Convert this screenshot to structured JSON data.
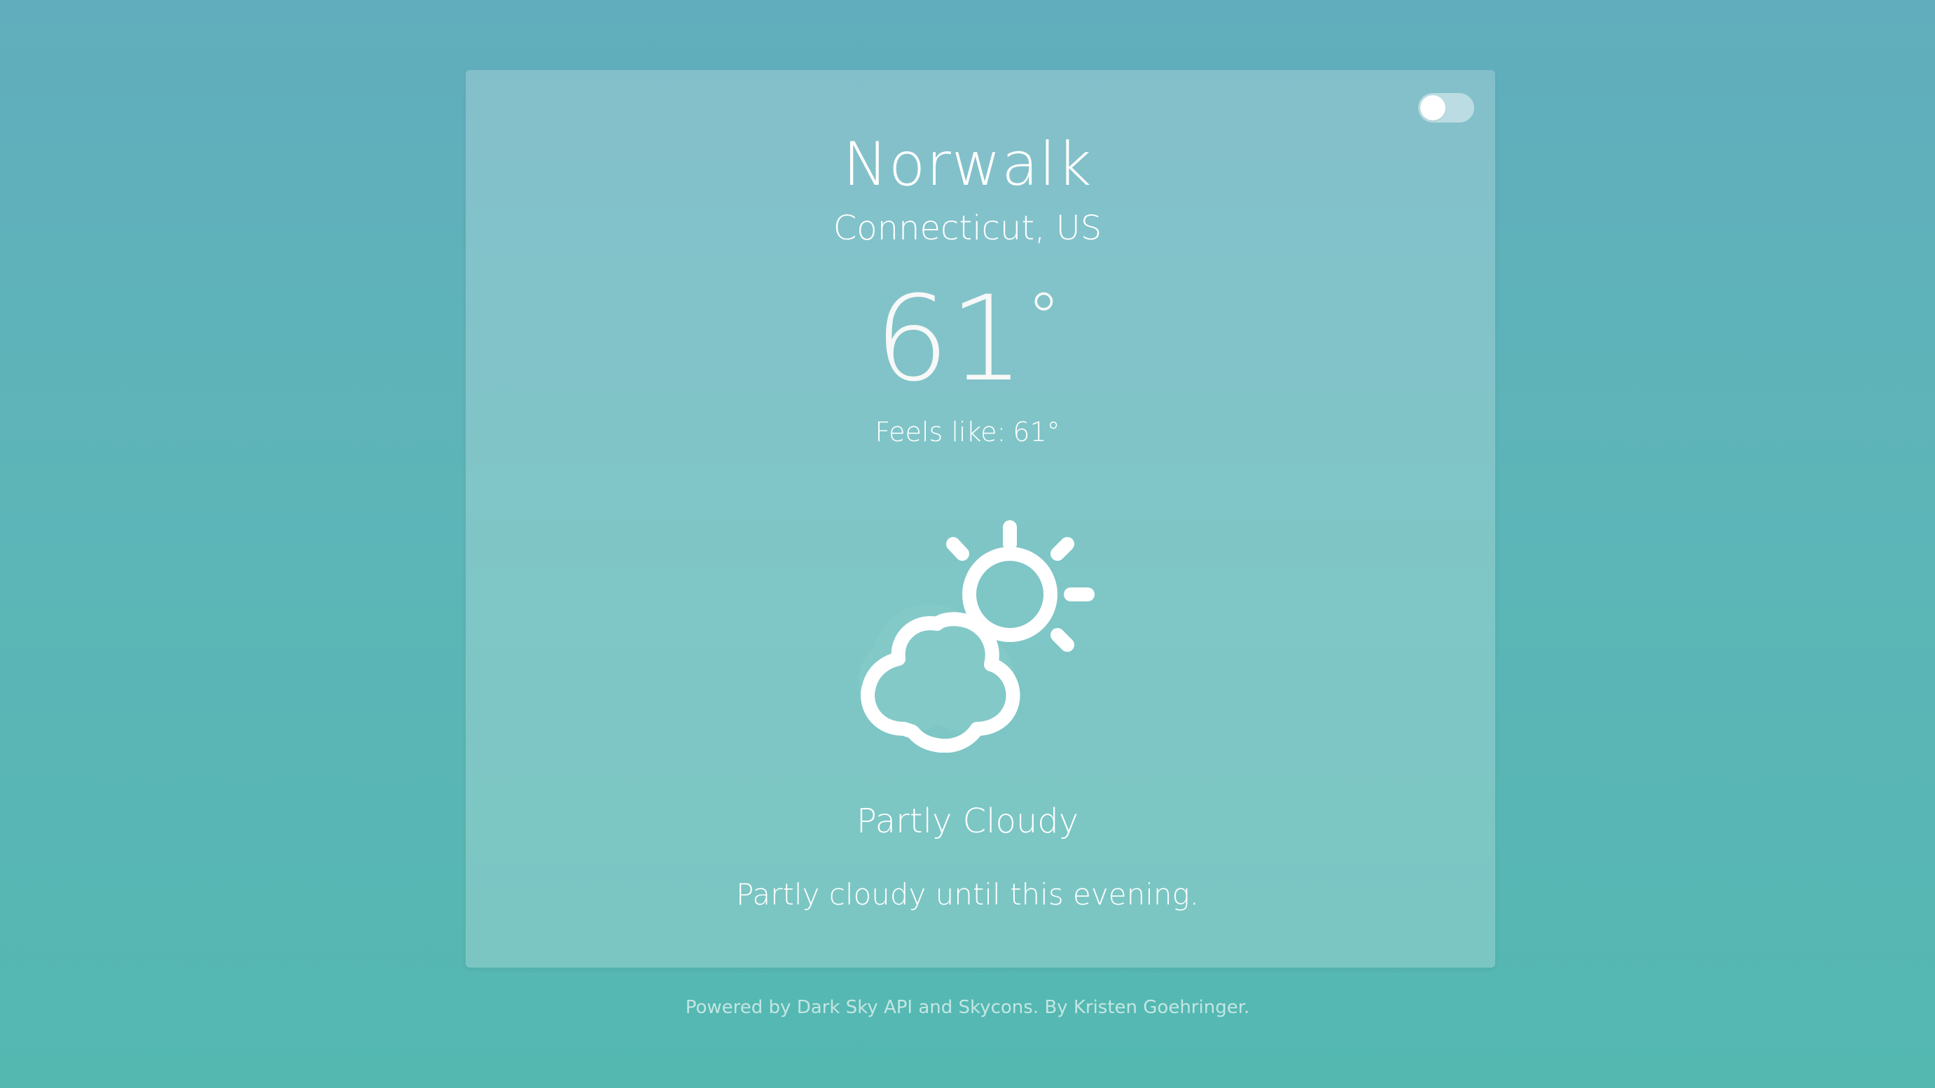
{
  "location": {
    "city": "Norwalk",
    "region": "Connecticut, US"
  },
  "current": {
    "temperature": "61",
    "degree_symbol": "°",
    "feels_like_label": "Feels like:",
    "feels_like_value": "61°",
    "summary": "Partly Cloudy",
    "detail": "Partly cloudy until this evening.",
    "icon": "partly-cloudy-day-icon"
  },
  "unit_toggle": {
    "state": "off"
  },
  "footer": {
    "prefix": "Powered by",
    "link_darksky": "Dark Sky API",
    "and": "and",
    "link_skycons": "Skycons.",
    "by": "By",
    "link_author": "Kristen Goehringer."
  },
  "colors": {
    "background_top": "#61adbd",
    "background_bottom": "#54b8b1",
    "text": "#ffffff"
  }
}
